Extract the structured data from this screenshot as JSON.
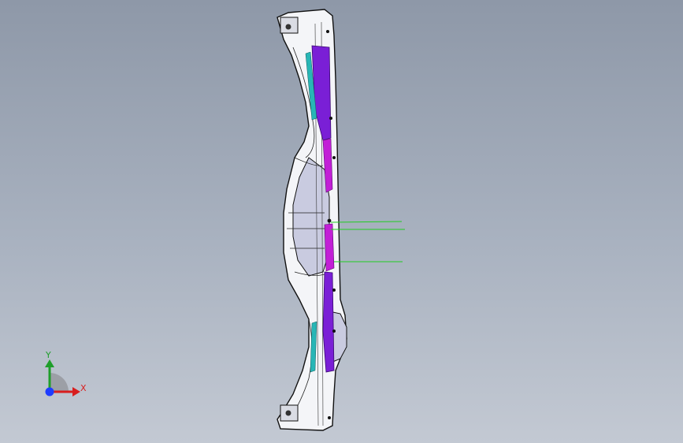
{
  "viewport": {
    "background_top": "#8e98a8",
    "background_bottom": "#c3c9d3"
  },
  "model": {
    "part": "bumper-side-view",
    "colors": {
      "body_fill": "#f4f5f8",
      "edge": "#111111",
      "shade": "#c9cbe0",
      "purple": "#7a1fd6",
      "magenta": "#c21fd6",
      "teal": "#28b6b6",
      "leader_line": "#22cc22"
    }
  },
  "triad": {
    "x_label": "X",
    "y_label": "Y",
    "x_color": "#d81e1e",
    "y_color": "#1e9e2a",
    "z_color": "#1e3cff",
    "x_icon": "x-axis-arrow-icon",
    "y_icon": "y-axis-arrow-icon",
    "z_icon": "z-axis-dot-icon"
  }
}
